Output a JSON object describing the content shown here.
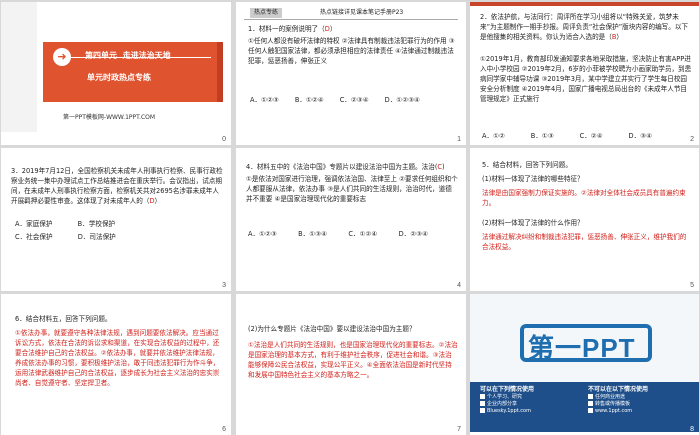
{
  "slides": [
    {
      "number": "0",
      "unit_prefix": "第四单元",
      "unit_title": "走进法治天地",
      "subtitle": "单元时政热点专练",
      "footer": "第一PPT模板网-WWW.1PPT.COM"
    },
    {
      "number": "1",
      "tag": "热点专练",
      "reference": "热点链接详见课本笔记手册P23",
      "q1": "1．材料一的案例说明了（",
      "q1_answer": "D",
      "q1_end": "）",
      "q1_opts": [
        "①任何人都没有破坏法律的特权",
        "②法律具有制裁违法犯罪行为的作用",
        "③任何人触犯国家法律，都必须承担相应的法律责任",
        "④法律通过制裁违法犯罪，惩恶扬善，伸张正义"
      ],
      "q1_choices": [
        "A．①②③",
        "B．①②④",
        "C．②③④",
        "D．①②③④"
      ]
    },
    {
      "number": "2",
      "q2": "2．依法护航，与法同行：周评所在学习小组将以“特殊关爱，筑梦未来”为主题制作一期手抄报。周评负责“社会保护”版块内容的编写。以下是他搜集的相关资料。你认为适合入选的是（",
      "q2_answer": "B",
      "q2_end": "）",
      "q2_items": [
        "①2019年1月，教育部印发通知要求各地采取措施，坚决防止有害APP进入中小学校园",
        "②2019年2月，6岁的小菲被学校聘为小画家助学员，到患病同学家中辅导功课",
        "③2019年3月，某中学建立并实行了学生每日校园安全分析制度",
        "④2019年4月，国家广播电视总局出台的《未成年人节目管理规定》正式施行"
      ],
      "q2_choices": [
        "A．①②",
        "B．①③",
        "C．②④",
        "D．③④"
      ]
    },
    {
      "number": "3",
      "q3": "3．2019年7月12日，全国检察机关未成年人刑事执行检察、民事行政检察业务统一集中办理试点工作总结推进会在重庆举行。会议指出，试点期间，在未成年人刑事执行检察方面，检察机关共对2695名涉罪未成年人开展羁押必要性审查。这体现了对未成年人的（",
      "q3_answer": "D",
      "q3_end": "）",
      "q3_choices": [
        "A．家庭保护",
        "B．学校保护",
        "C．社会保护",
        "D．司法保护"
      ]
    },
    {
      "number": "4",
      "q4": "4．材料五中的《法治中国》专题片以建设法治中国为主题。法治(",
      "q4_answer": "C",
      "q4_end": ")",
      "q4_opts": "①是依法对国家进行治理，强调依法治国、法律至上  ②要求任何组织和个人都要服从法律，依法办事  ③是人们共同的生活规则，治治时代，道德并不重要  ④是国家治理现代化的重要标志",
      "q4_choices": [
        "A．①②③",
        "B．①③④",
        "C．①②④",
        "D．②③④"
      ]
    },
    {
      "number": "5",
      "q5_intro": "5．结合材料，回答下列问题。",
      "q5_1": "(1)材料一体现了法律的哪些特征？",
      "q5_1_answer": "法律是由国家强制力保证实施的。②法律对全体社会成员具有普遍约束力。",
      "q5_2": "(2)材料一体现了法律的什么作用？",
      "q5_2_answer": "法律通过解决纠纷和制裁违法犯罪，惩恶扬善、伸张正义，维护我们的合法权益。"
    },
    {
      "number": "6",
      "q6_intro": "6．结合材料五，回答下列问题。",
      "q6_body": "①依法办事，就要遵守各种法律法规，遇到问题要依法解决。应当通过诉讼方式，依法在合法的诉讼求和渠道，在实现合法权益的过程中，还要合法维护自己的合法权益。②依法办事，就要并依法维护法律法规，养成依法办事的习惯，要积极维护法治，敢于同违法犯罪行为作斗争，运用法律武器维护自己的合法权益，逐步成长为社会主义法治的忠实崇尚者、自觉遵守者、坚定捍卫者。"
    },
    {
      "number": "7",
      "q7": "(2)为什么专题片《法治中国》要以建设法治中国为主题？",
      "q7_answer": "①法治是人们共同的生活规则，也是国家治理现代化的重要标志。②法治是国家治理的基本方式，有利于维护社会秩序，促进社会和谐。③法治能够保障公民合法权益，实现公平正义。④全面依法治国是新时代坚持和发展中国特色社会主义的基本方略之一。"
    },
    {
      "number": "8",
      "logo": "第一PPT",
      "left_title": "可以在下列情况使用",
      "right_title": "不可以在以下情况使用",
      "left_lines": [
        "个人学习、研究",
        "企业内部分享",
        "Bluesky.1ppt.com"
      ],
      "right_lines": [
        "任何商业用途",
        "转售或传播模板",
        "www.1ppt.com"
      ]
    }
  ]
}
